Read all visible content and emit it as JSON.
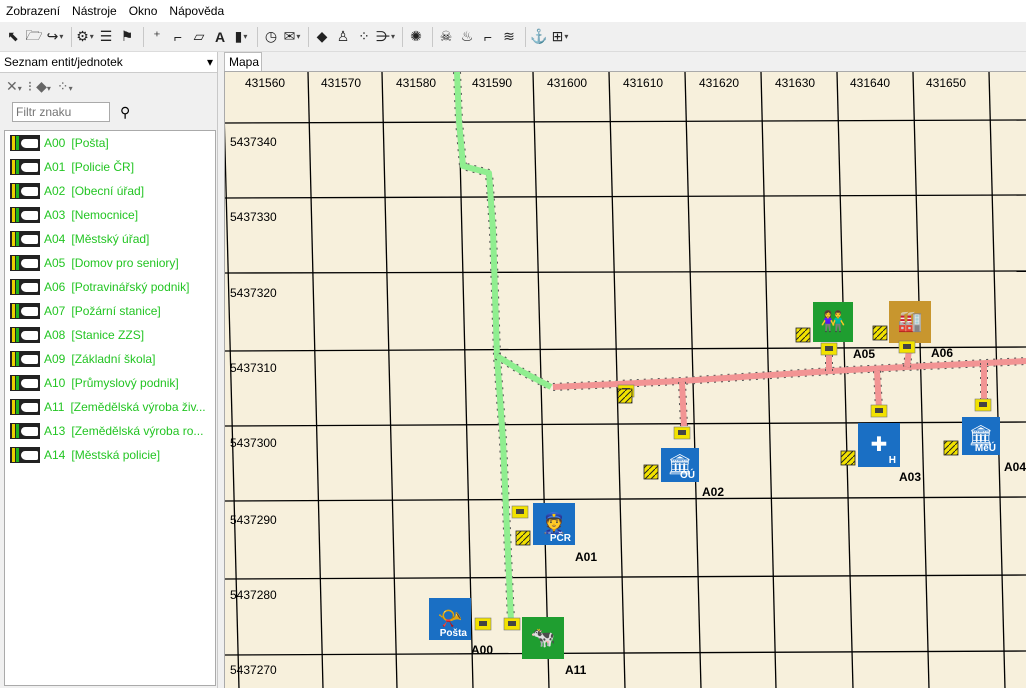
{
  "menu": {
    "items": [
      "Zobrazení",
      "Nástroje",
      "Okno",
      "Nápověda"
    ]
  },
  "panel": {
    "title": "Seznam entit/jednotek",
    "filter_placeholder": "Filtr znaku",
    "entities": [
      {
        "code": "A00",
        "name": "[Pošta]"
      },
      {
        "code": "A01",
        "name": "[Policie ČR]"
      },
      {
        "code": "A02",
        "name": "[Obecní úřad]"
      },
      {
        "code": "A03",
        "name": "[Nemocnice]"
      },
      {
        "code": "A04",
        "name": "[Městský úřad]"
      },
      {
        "code": "A05",
        "name": "[Domov pro seniory]"
      },
      {
        "code": "A06",
        "name": "[Potravinářský podnik]"
      },
      {
        "code": "A07",
        "name": "[Požární stanice]"
      },
      {
        "code": "A08",
        "name": "[Stanice ZZS]"
      },
      {
        "code": "A09",
        "name": "[Základní škola]"
      },
      {
        "code": "A10",
        "name": "[Průmyslový podnik]"
      },
      {
        "code": "A11",
        "name": "[Zemědělská výroba živ..."
      },
      {
        "code": "A13",
        "name": "[Zemědělská výroba ro..."
      },
      {
        "code": "A14",
        "name": "[Městská policie]"
      }
    ]
  },
  "map": {
    "tab_label": "Mapa",
    "x_coords": [
      "431560",
      "431570",
      "431580",
      "431590",
      "431600",
      "431610",
      "431620",
      "431630",
      "431640",
      "431650"
    ],
    "y_coords": [
      "5437340",
      "5437330",
      "5437320",
      "5437310",
      "5437300",
      "5437290",
      "5437280",
      "5437270"
    ],
    "units": [
      {
        "label": "A00",
        "sign": "Pošta"
      },
      {
        "label": "A01",
        "sign": "PČR"
      },
      {
        "label": "A02",
        "sign": "OÚ"
      },
      {
        "label": "A03",
        "sign": "H"
      },
      {
        "label": "A04",
        "sign": "MěÚ"
      },
      {
        "label": "A05",
        "sign": ""
      },
      {
        "label": "A06",
        "sign": ""
      },
      {
        "label": "A11",
        "sign": ""
      }
    ],
    "colors": {
      "background": "#f7f0dc",
      "green_line": "#90ee90",
      "red_line": "#f29494",
      "grid": "#000000",
      "blue_sign": "#1a6fc4",
      "green_sign": "#1f9e30",
      "orange_sign": "#c8962e"
    }
  }
}
